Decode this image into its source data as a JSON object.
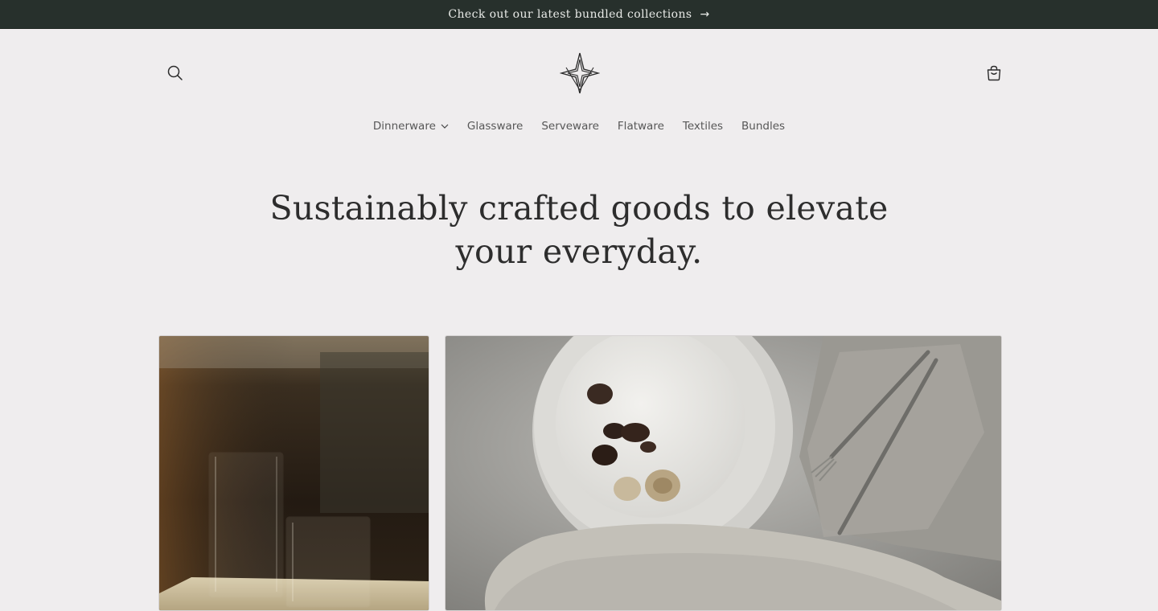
{
  "announcement": {
    "text": "Check out our latest bundled collections",
    "arrow": "→"
  },
  "header": {
    "search_icon": "search-icon",
    "logo_icon": "star-logo",
    "cart_icon": "cart-icon"
  },
  "nav": {
    "items": [
      {
        "label": "Dinnerware",
        "has_dropdown": true
      },
      {
        "label": "Glassware"
      },
      {
        "label": "Serveware"
      },
      {
        "label": "Flatware"
      },
      {
        "label": "Textiles"
      },
      {
        "label": "Bundles"
      }
    ]
  },
  "hero": {
    "line1": "Sustainably crafted goods to elevate",
    "line2": "your everyday."
  },
  "images": {
    "left": "glassware-photo",
    "right": "plate-with-mushrooms-photo"
  },
  "colors": {
    "background": "#efedee",
    "announcement_bg": "#27302c",
    "text": "#2b2b2b"
  }
}
